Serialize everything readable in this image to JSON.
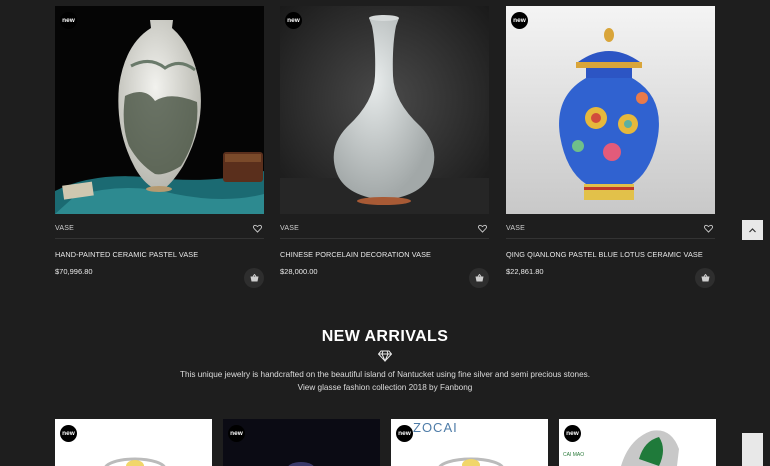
{
  "products": [
    {
      "badge": "new",
      "category": "VASE",
      "name": "HAND-PAINTED CERAMIC PASTEL VASE",
      "price": "$70,996.80"
    },
    {
      "badge": "new",
      "category": "VASE",
      "name": "CHINESE PORCELAIN DECORATION VASE",
      "price": "$28,000.00"
    },
    {
      "badge": "new",
      "category": "VASE",
      "name": "QING QIANLONG PASTEL BLUE LOTUS CERAMIC VASE",
      "price": "$22,861.80"
    }
  ],
  "new_arrivals": {
    "title": "NEW ARRIVALS",
    "line1": "This unique jewelry is handcrafted on the beautiful island of Nantucket using fine silver and semi precious stones.",
    "line2": "View glasse fashion collection 2018 by Fanbong"
  },
  "arrivals": [
    {
      "badge": "new"
    },
    {
      "badge": "new"
    },
    {
      "badge": "new",
      "brand": "ZOCAI"
    },
    {
      "badge": "new",
      "brand": "CAI MAO"
    }
  ],
  "colors": {
    "background": "#1e1e1e",
    "badge": "#000000",
    "accent_blue": "#2f59c8"
  }
}
